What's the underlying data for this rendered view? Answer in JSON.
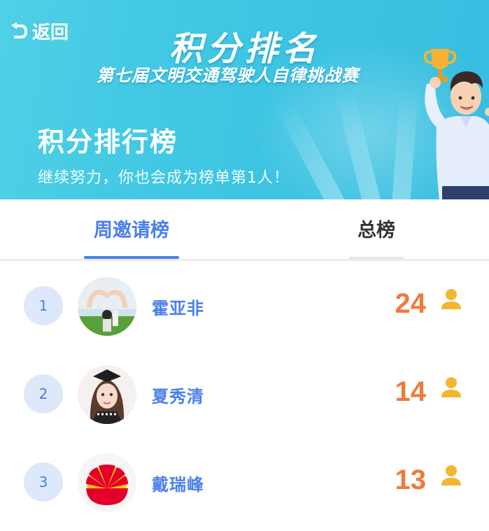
{
  "header": {
    "back_label": "返回",
    "title": "积分排名",
    "subtitle": "第七届文明交通驾驶人自律挑战赛",
    "heading": "积分排行榜",
    "tagline": "继续努力，你也会成为榜单第1人！"
  },
  "tabs": [
    {
      "label": "周邀请榜",
      "active": true
    },
    {
      "label": "总榜",
      "active": false
    }
  ],
  "ranking": [
    {
      "rank": "1",
      "name": "霍亚非",
      "score": "24",
      "avatar": "heart-hands-avatar"
    },
    {
      "rank": "2",
      "name": "夏秀清",
      "score": "14",
      "avatar": "girl-portrait-avatar"
    },
    {
      "rank": "3",
      "name": "戴瑞峰",
      "score": "13",
      "avatar": "petrochina-logo-avatar"
    }
  ],
  "colors": {
    "banner": "#3ec6e3",
    "accent": "#4a80e8",
    "score": "#f07a3a",
    "person_icon": "#f2b632",
    "rank_bg": "#dde8fb"
  },
  "icons": {
    "back": "back-arrow-icon",
    "score_unit": "person-icon",
    "mascot": "trophy-mascot-illustration"
  }
}
